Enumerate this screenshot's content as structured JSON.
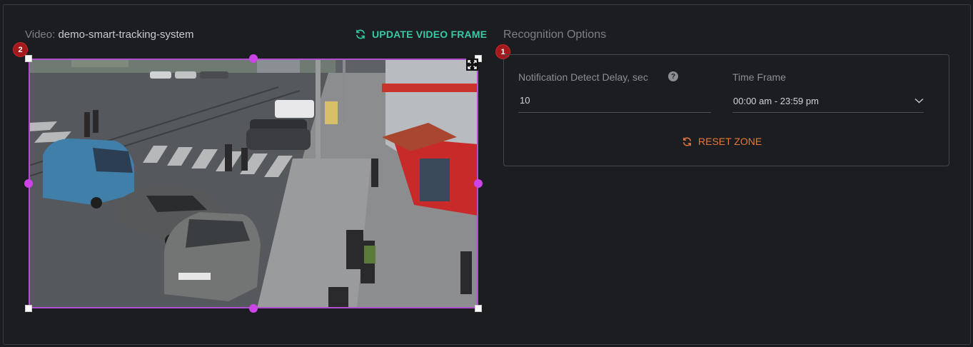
{
  "video": {
    "prefix": "Video:",
    "name": "demo-smart-tracking-system",
    "update_label": "UPDATE VIDEO FRAME"
  },
  "recognition": {
    "title": "Recognition Options",
    "delay_label": "Notification Detect Delay, sec",
    "delay_help": "?",
    "delay_value": "10",
    "timeframe_label": "Time Frame",
    "timeframe_value": "00:00 am - 23:59 pm",
    "reset_label": "RESET ZONE"
  },
  "badges": {
    "zone_badge": "2",
    "options_badge": "1"
  },
  "colors": {
    "accent_green": "#3ac8a4",
    "accent_orange": "#e4783c",
    "zone_purple": "#b24fd0",
    "badge_red": "#a3191c"
  }
}
